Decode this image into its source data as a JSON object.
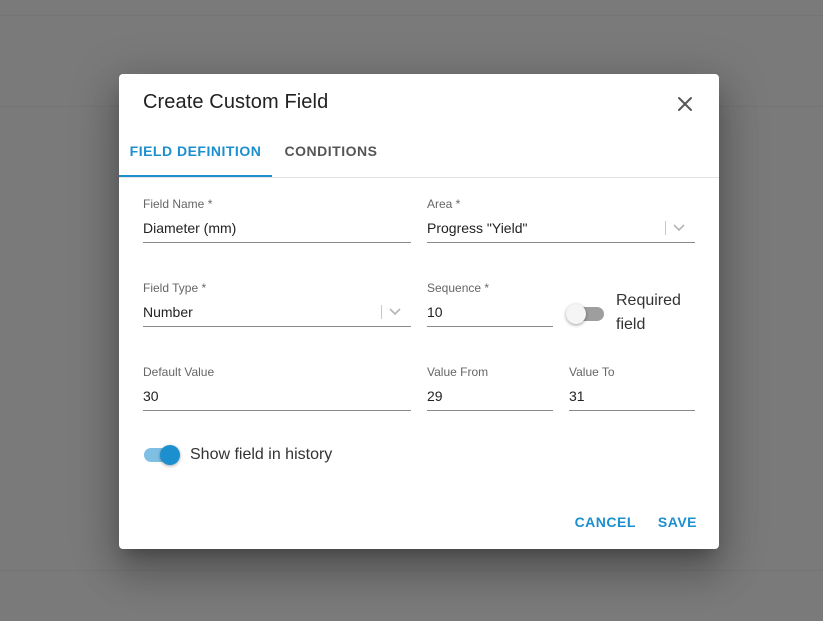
{
  "dialog": {
    "title": "Create Custom Field",
    "close_icon": "close-icon"
  },
  "tabs": [
    {
      "label": "FIELD DEFINITION",
      "active": true
    },
    {
      "label": "CONDITIONS",
      "active": false
    }
  ],
  "fields": {
    "field_name": {
      "label": "Field Name *",
      "value": "Diameter (mm)"
    },
    "area": {
      "label": "Area *",
      "value": "Progress \"Yield\""
    },
    "field_type": {
      "label": "Field Type *",
      "value": "Number"
    },
    "sequence": {
      "label": "Sequence *",
      "value": "10"
    },
    "default_value": {
      "label": "Default Value",
      "value": "30"
    },
    "value_from": {
      "label": "Value From",
      "value": "29"
    },
    "value_to": {
      "label": "Value To",
      "value": "31"
    }
  },
  "toggles": {
    "required": {
      "label_line1": "Required",
      "label_line2": "field",
      "on": false
    },
    "show_history": {
      "label": "Show field in history",
      "on": true
    }
  },
  "actions": {
    "cancel": "CANCEL",
    "save": "SAVE"
  },
  "colors": {
    "accent": "#1c8fcf",
    "overlay": "#7a7a7a",
    "dialog_bg": "#ffffff"
  }
}
